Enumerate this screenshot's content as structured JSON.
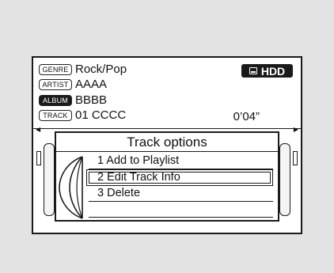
{
  "track_info": {
    "genre_tag": "GENRE",
    "genre": "Rock/Pop",
    "artist_tag": "ARTIST",
    "artist": "AAAA",
    "album_tag": "ALBUM",
    "album": "BBBB",
    "track_tag": "TRACK",
    "track": "01 CCCC",
    "elapsed_time": "0’04”"
  },
  "source": {
    "label": "HDD",
    "icon": "hdd-icon"
  },
  "popup": {
    "title": "Track options",
    "items": [
      {
        "label": "1 Add to Playlist",
        "selected": false
      },
      {
        "label": "2 Edit Track Info",
        "selected": true
      },
      {
        "label": "3 Delete",
        "selected": false
      }
    ]
  }
}
